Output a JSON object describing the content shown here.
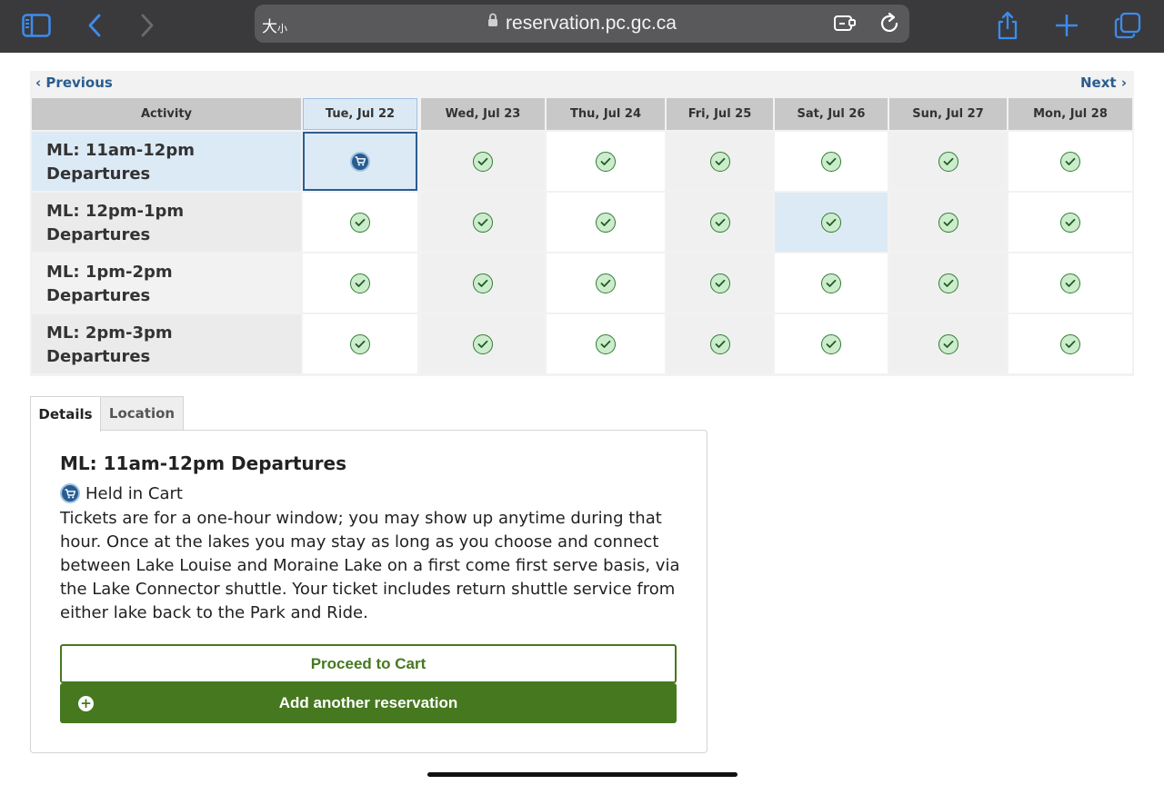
{
  "browser": {
    "text_size_label": "大",
    "text_size_small": "小",
    "url": "reservation.pc.gc.ca"
  },
  "calendar": {
    "prev_label": "Previous",
    "next_label": "Next",
    "activity_header": "Activity",
    "days": [
      "Tue, Jul 22",
      "Wed, Jul 23",
      "Thu, Jul 24",
      "Fri, Jul 25",
      "Sat, Jul 26",
      "Sun, Jul 27",
      "Mon, Jul 28"
    ],
    "rows": [
      {
        "line1": "ML: 11am-12pm",
        "line2": "Departures",
        "status": [
          "in-cart",
          "available",
          "available",
          "available",
          "available",
          "available",
          "available"
        ]
      },
      {
        "line1": "ML: 12pm-1pm",
        "line2": "Departures",
        "status": [
          "available",
          "available",
          "available",
          "available",
          "available",
          "available",
          "available"
        ]
      },
      {
        "line1": "ML: 1pm-2pm",
        "line2": "Departures",
        "status": [
          "available",
          "available",
          "available",
          "available",
          "available",
          "available",
          "available"
        ]
      },
      {
        "line1": "ML: 2pm-3pm",
        "line2": "Departures",
        "status": [
          "available",
          "available",
          "available",
          "available",
          "available",
          "available",
          "available"
        ]
      }
    ]
  },
  "tabs": {
    "details": "Details",
    "location": "Location"
  },
  "details": {
    "title": "ML: 11am-12pm Departures",
    "status": "Held in Cart",
    "description": "Tickets are for a one-hour window; you may show up anytime during that hour. Once at the lakes you may stay as long as you choose and connect between Lake Louise and Moraine Lake on a first come first serve basis, via the Lake Connector shuttle. Your ticket includes return shuttle service from either lake back to the Park and Ride.",
    "proceed_label": "Proceed to Cart",
    "add_label": "Add another reservation"
  },
  "colors": {
    "accent_blue": "#2a5d8f",
    "primary_green": "#46781f",
    "available_green": "#2e7d32"
  }
}
